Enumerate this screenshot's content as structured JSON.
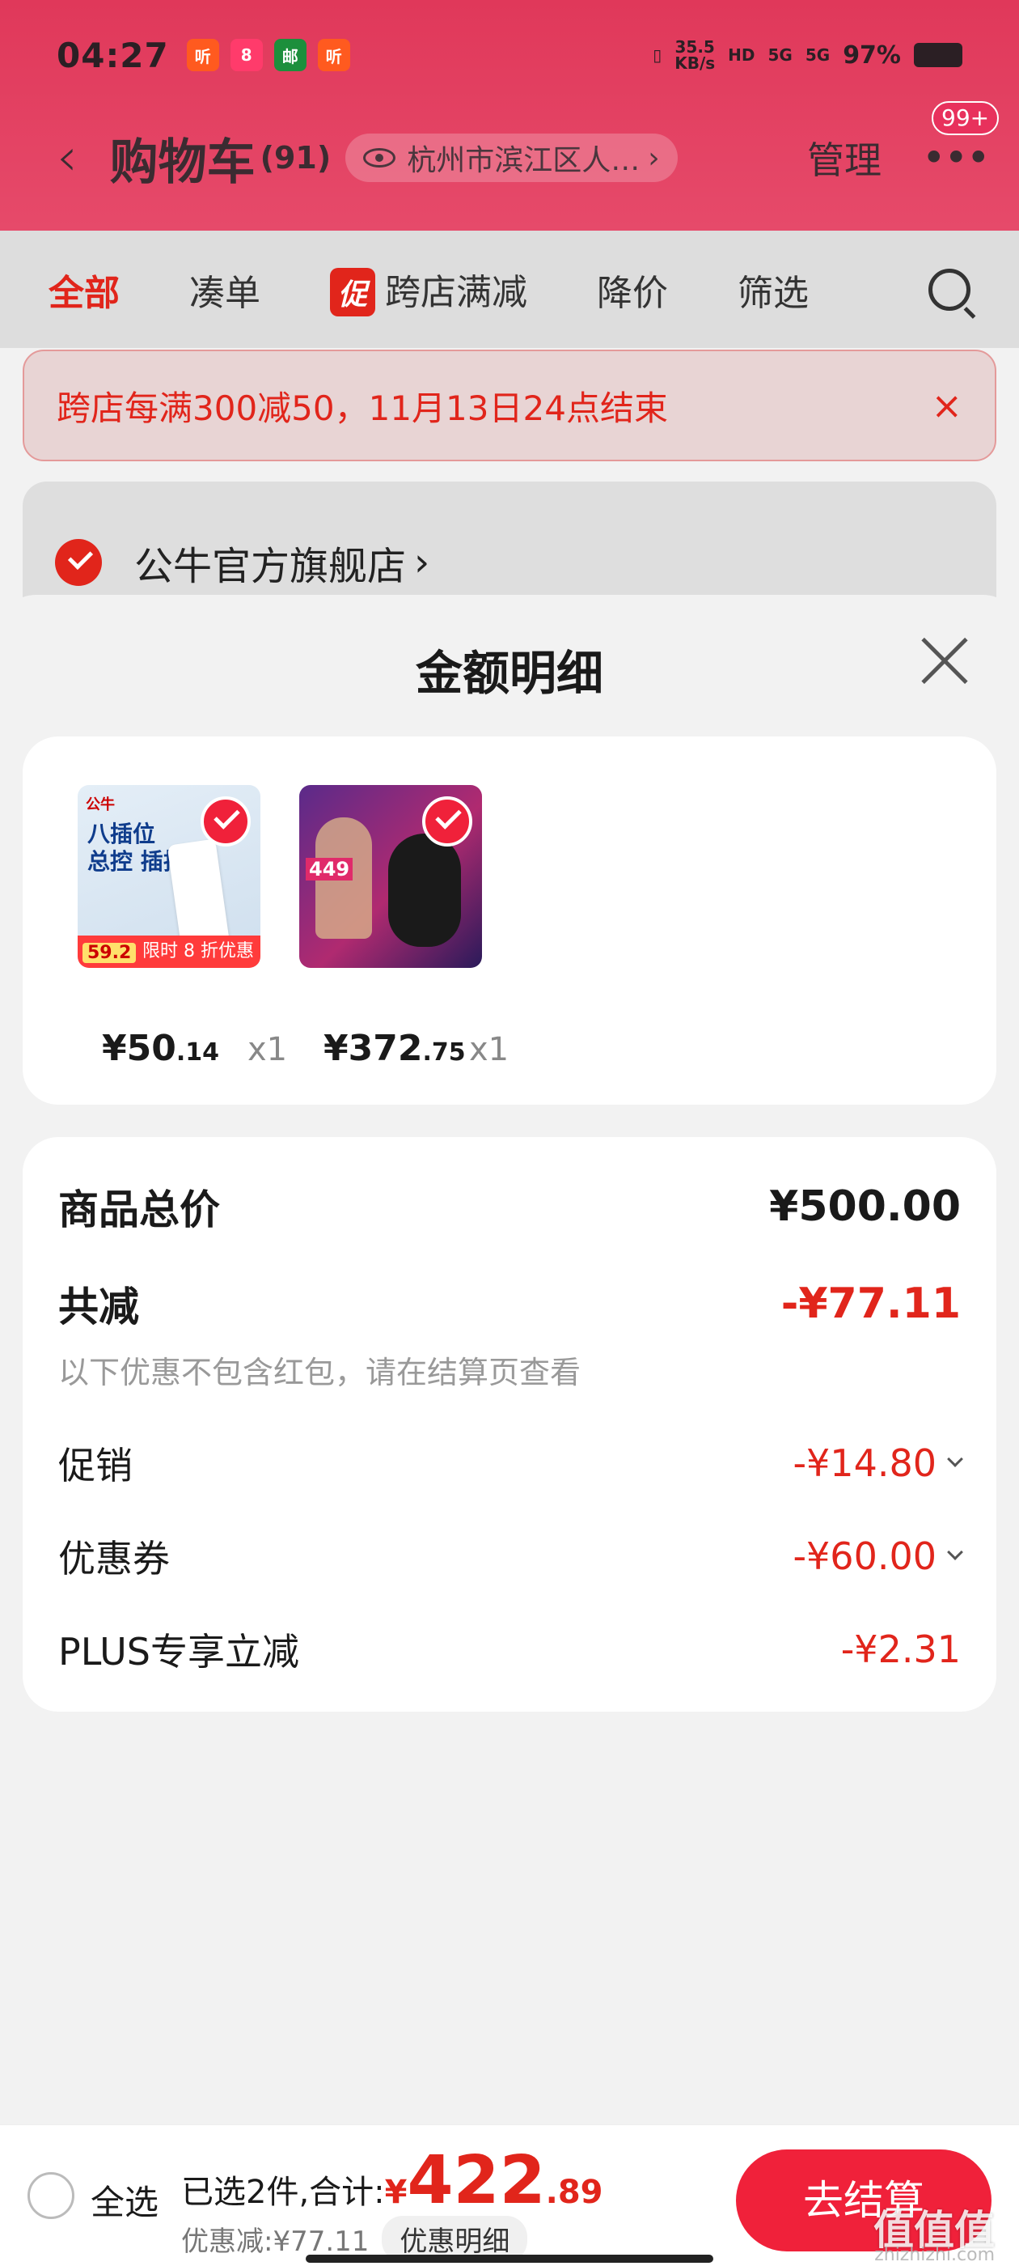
{
  "status_bar": {
    "time": "04:27",
    "app_badges": [
      "听",
      "8",
      "邮",
      "听"
    ],
    "net_speed": "35.5",
    "net_unit": "KB/s",
    "hd": "HD",
    "signal1": "5G",
    "signal2": "5G",
    "battery": "97%"
  },
  "nav": {
    "title": "购物车",
    "count": "(91)",
    "location": "杭州市滨江区人…",
    "location_arrow": "›",
    "manage": "管理",
    "more_badge": "99+"
  },
  "tabs": [
    "全部",
    "凑单",
    "跨店满减",
    "降价",
    "筛选"
  ],
  "promo_tag": "促",
  "notice": {
    "text": "跨店每满300减50，11月13日24点结束",
    "close": "×"
  },
  "store": {
    "name": "公牛官方旗舰店",
    "arrow": "›"
  },
  "sheet": {
    "title": "金额明细",
    "items": [
      {
        "price_int": "¥50",
        "price_dec": ".14",
        "qty": "x1",
        "img_head": "公牛",
        "img_title_1": "八插位",
        "img_title_2": "总控 插排",
        "img_promo": "限时 8 折优惠",
        "img_price": "59.2"
      },
      {
        "price_int": "¥372",
        "price_dec": ".75",
        "qty": "x1",
        "img_tag": "449"
      }
    ],
    "summary": {
      "goods_total_label": "商品总价",
      "goods_total_value": "¥500.00",
      "total_discount_label": "共减",
      "total_discount_value": "-¥77.11",
      "note": "以下优惠不包含红包，请在结算页查看",
      "promo_label": "促销",
      "promo_value": "-¥14.80",
      "coupon_label": "优惠券",
      "coupon_value": "-¥60.00",
      "plus_label": "PLUS专享立减",
      "plus_value": "-¥2.31"
    }
  },
  "bottom": {
    "select_all": "全选",
    "selected_label": "已选2件,合计:",
    "currency": "¥",
    "total_int": "422",
    "total_dec": ".89",
    "discount_text": "优惠减:¥77.11",
    "detail_button": "优惠明细",
    "checkout": "去结算",
    "watermark": "值值值",
    "watermark_sub": "zhizhizhi.com"
  },
  "colors": {
    "accent_red": "#e1251b",
    "checkout_red": "#f0213a",
    "header_pink": "#e0385a"
  }
}
